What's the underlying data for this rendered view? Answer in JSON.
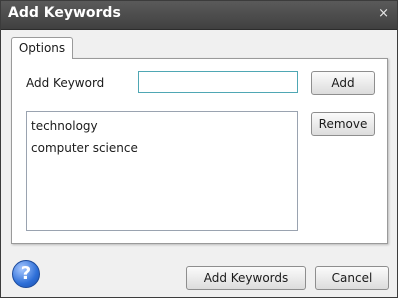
{
  "window": {
    "title": "Add Keywords",
    "close_glyph": "×"
  },
  "tabs": [
    {
      "label": "Options",
      "active": true
    }
  ],
  "form": {
    "keyword_label": "Add Keyword",
    "keyword_value": "",
    "add_label": "Add",
    "remove_label": "Remove",
    "keywords": [
      "technology",
      "computer science"
    ]
  },
  "footer": {
    "help_glyph": "?",
    "add_keywords_label": "Add Keywords",
    "cancel_label": "Cancel"
  },
  "icons": {
    "close": "close-icon",
    "help": "help-icon"
  }
}
